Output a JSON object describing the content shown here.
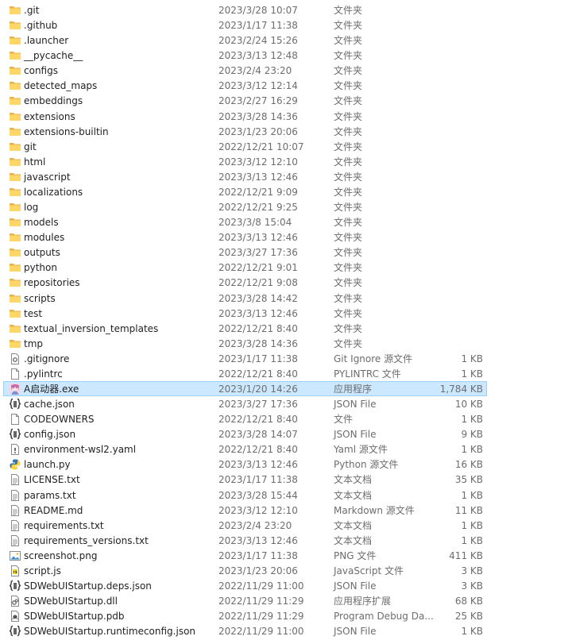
{
  "files": [
    {
      "name": ".git",
      "date": "2023/3/28 10:07",
      "type": "文件夹",
      "size": "",
      "icon": "folder-icon"
    },
    {
      "name": ".github",
      "date": "2023/1/17 11:38",
      "type": "文件夹",
      "size": "",
      "icon": "folder-icon"
    },
    {
      "name": ".launcher",
      "date": "2023/2/24 15:26",
      "type": "文件夹",
      "size": "",
      "icon": "folder-icon"
    },
    {
      "name": "__pycache__",
      "date": "2023/3/13 12:48",
      "type": "文件夹",
      "size": "",
      "icon": "folder-icon"
    },
    {
      "name": "configs",
      "date": "2023/2/4 23:20",
      "type": "文件夹",
      "size": "",
      "icon": "folder-icon"
    },
    {
      "name": "detected_maps",
      "date": "2023/3/12 12:14",
      "type": "文件夹",
      "size": "",
      "icon": "folder-icon"
    },
    {
      "name": "embeddings",
      "date": "2023/2/27 16:29",
      "type": "文件夹",
      "size": "",
      "icon": "folder-icon"
    },
    {
      "name": "extensions",
      "date": "2023/3/28 14:36",
      "type": "文件夹",
      "size": "",
      "icon": "folder-icon"
    },
    {
      "name": "extensions-builtin",
      "date": "2023/1/23 20:06",
      "type": "文件夹",
      "size": "",
      "icon": "folder-icon"
    },
    {
      "name": "git",
      "date": "2022/12/21 10:07",
      "type": "文件夹",
      "size": "",
      "icon": "folder-icon"
    },
    {
      "name": "html",
      "date": "2023/3/12 12:10",
      "type": "文件夹",
      "size": "",
      "icon": "folder-icon"
    },
    {
      "name": "javascript",
      "date": "2023/3/13 12:46",
      "type": "文件夹",
      "size": "",
      "icon": "folder-icon"
    },
    {
      "name": "localizations",
      "date": "2022/12/21 9:09",
      "type": "文件夹",
      "size": "",
      "icon": "folder-icon"
    },
    {
      "name": "log",
      "date": "2022/12/21 9:25",
      "type": "文件夹",
      "size": "",
      "icon": "folder-icon"
    },
    {
      "name": "models",
      "date": "2023/3/8 15:04",
      "type": "文件夹",
      "size": "",
      "icon": "folder-icon"
    },
    {
      "name": "modules",
      "date": "2023/3/13 12:46",
      "type": "文件夹",
      "size": "",
      "icon": "folder-icon"
    },
    {
      "name": "outputs",
      "date": "2023/3/27 17:36",
      "type": "文件夹",
      "size": "",
      "icon": "folder-icon"
    },
    {
      "name": "python",
      "date": "2022/12/21 9:01",
      "type": "文件夹",
      "size": "",
      "icon": "folder-icon"
    },
    {
      "name": "repositories",
      "date": "2022/12/21 9:08",
      "type": "文件夹",
      "size": "",
      "icon": "folder-icon"
    },
    {
      "name": "scripts",
      "date": "2023/3/28 14:42",
      "type": "文件夹",
      "size": "",
      "icon": "folder-icon"
    },
    {
      "name": "test",
      "date": "2023/3/13 12:46",
      "type": "文件夹",
      "size": "",
      "icon": "folder-icon"
    },
    {
      "name": "textual_inversion_templates",
      "date": "2022/12/21 8:40",
      "type": "文件夹",
      "size": "",
      "icon": "folder-icon"
    },
    {
      "name": "tmp",
      "date": "2023/3/28 14:36",
      "type": "文件夹",
      "size": "",
      "icon": "folder-icon"
    },
    {
      "name": ".gitignore",
      "date": "2023/1/17 11:38",
      "type": "Git Ignore 源文件",
      "size": "1 KB",
      "icon": "settings-file-icon"
    },
    {
      "name": ".pylintrc",
      "date": "2022/12/21 8:40",
      "type": "PYLINTRC 文件",
      "size": "1 KB",
      "icon": "blank-file-icon"
    },
    {
      "name": "A启动器.exe",
      "date": "2023/1/20 14:26",
      "type": "应用程序",
      "size": "1,784 KB",
      "icon": "app-avatar-icon",
      "selected": true
    },
    {
      "name": "cache.json",
      "date": "2023/3/27 17:36",
      "type": "JSON File",
      "size": "10 KB",
      "icon": "json-file-icon"
    },
    {
      "name": "CODEOWNERS",
      "date": "2022/12/21 8:40",
      "type": "文件",
      "size": "1 KB",
      "icon": "blank-file-icon"
    },
    {
      "name": "config.json",
      "date": "2023/3/28 14:07",
      "type": "JSON File",
      "size": "9 KB",
      "icon": "json-file-icon"
    },
    {
      "name": "environment-wsl2.yaml",
      "date": "2022/12/21 8:40",
      "type": "Yaml 源文件",
      "size": "1 KB",
      "icon": "yaml-file-icon"
    },
    {
      "name": "launch.py",
      "date": "2023/3/13 12:46",
      "type": "Python 源文件",
      "size": "16 KB",
      "icon": "python-file-icon"
    },
    {
      "name": "LICENSE.txt",
      "date": "2023/1/17 11:38",
      "type": "文本文档",
      "size": "35 KB",
      "icon": "text-file-icon"
    },
    {
      "name": "params.txt",
      "date": "2023/3/28 15:44",
      "type": "文本文档",
      "size": "1 KB",
      "icon": "text-file-icon"
    },
    {
      "name": "README.md",
      "date": "2023/3/12 12:10",
      "type": "Markdown 源文件",
      "size": "11 KB",
      "icon": "text-file-icon"
    },
    {
      "name": "requirements.txt",
      "date": "2023/2/4 23:20",
      "type": "文本文档",
      "size": "1 KB",
      "icon": "text-file-icon"
    },
    {
      "name": "requirements_versions.txt",
      "date": "2023/3/13 12:46",
      "type": "文本文档",
      "size": "1 KB",
      "icon": "text-file-icon"
    },
    {
      "name": "screenshot.png",
      "date": "2023/1/17 11:38",
      "type": "PNG 文件",
      "size": "411 KB",
      "icon": "image-file-icon"
    },
    {
      "name": "script.js",
      "date": "2023/1/23 20:06",
      "type": "JavaScript 文件",
      "size": "3 KB",
      "icon": "js-file-icon"
    },
    {
      "name": "SDWebUIStartup.deps.json",
      "date": "2022/11/29 11:00",
      "type": "JSON File",
      "size": "3 KB",
      "icon": "json-file-icon"
    },
    {
      "name": "SDWebUIStartup.dll",
      "date": "2022/11/29 11:29",
      "type": "应用程序扩展",
      "size": "68 KB",
      "icon": "dll-file-icon"
    },
    {
      "name": "SDWebUIStartup.pdb",
      "date": "2022/11/29 11:29",
      "type": "Program Debug Da...",
      "size": "25 KB",
      "icon": "pdb-file-icon"
    },
    {
      "name": "SDWebUIStartup.runtimeconfig.json",
      "date": "2022/11/29 11:00",
      "type": "JSON File",
      "size": "1 KB",
      "icon": "json-file-icon"
    }
  ]
}
